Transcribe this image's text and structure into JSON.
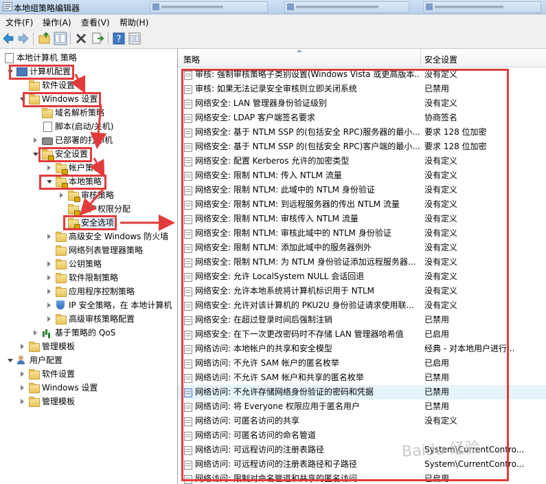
{
  "window": {
    "title": "本地组策略编辑器"
  },
  "menu": [
    "文件(F)",
    "操作(A)",
    "查看(V)",
    "帮助(H)"
  ],
  "toolbar": [
    {
      "icon": "back-arrow-icon"
    },
    {
      "icon": "forward-arrow-icon"
    },
    {
      "icon": "up-folder-icon"
    },
    {
      "icon": "show-hide-tree-icon"
    },
    {
      "icon": "delete-x-icon"
    },
    {
      "icon": "export-list-icon"
    },
    {
      "icon": "help-icon"
    },
    {
      "icon": "properties-icon"
    }
  ],
  "tree": [
    {
      "label": "本地计算机 策略",
      "icon": "page",
      "expand": "none"
    },
    {
      "label": "计算机配置",
      "icon": "pc",
      "expand": "open"
    },
    {
      "label": "软件设置",
      "icon": "folder",
      "expand": "none"
    },
    {
      "label": "Windows 设置",
      "icon": "folder",
      "expand": "open"
    },
    {
      "label": "域名解析策略",
      "icon": "folder",
      "expand": "none"
    },
    {
      "label": "脚本(启动/关机)",
      "icon": "page",
      "expand": "none"
    },
    {
      "label": "已部署的打印机",
      "icon": "printer",
      "expand": "closed"
    },
    {
      "label": "安全设置",
      "icon": "folder-lock",
      "expand": "open"
    },
    {
      "label": "帐户策略",
      "icon": "folder-lock",
      "expand": "closed"
    },
    {
      "label": "本地策略",
      "icon": "folder-lock",
      "expand": "open"
    },
    {
      "label": "审核策略",
      "icon": "folder-lock",
      "expand": "closed"
    },
    {
      "label": "用户权限分配",
      "icon": "folder-lock",
      "expand": "none"
    },
    {
      "label": "安全选项",
      "icon": "folder-lock",
      "expand": "none"
    },
    {
      "label": "高级安全 Windows 防火墙",
      "icon": "folder",
      "expand": "closed"
    },
    {
      "label": "网络列表管理器策略",
      "icon": "folder",
      "expand": "none"
    },
    {
      "label": "公钥策略",
      "icon": "folder",
      "expand": "closed"
    },
    {
      "label": "软件限制策略",
      "icon": "folder",
      "expand": "closed"
    },
    {
      "label": "应用程序控制策略",
      "icon": "folder",
      "expand": "closed"
    },
    {
      "label": "IP 安全策略，在 本地计算机",
      "icon": "shield",
      "expand": "closed"
    },
    {
      "label": "高级审核策略配置",
      "icon": "folder",
      "expand": "closed"
    },
    {
      "label": "基于策略的 QoS",
      "icon": "chart",
      "expand": "closed"
    },
    {
      "label": "管理模板",
      "icon": "folder",
      "expand": "closed"
    },
    {
      "label": "用户配置",
      "icon": "user",
      "expand": "open"
    },
    {
      "label": "软件设置",
      "icon": "folder",
      "expand": "closed"
    },
    {
      "label": "Windows 设置",
      "icon": "folder",
      "expand": "closed"
    },
    {
      "label": "管理模板",
      "icon": "folder",
      "expand": "closed"
    }
  ],
  "list": {
    "col_policy": "策略",
    "col_setting": "安全设置",
    "rows": [
      {
        "policy": "审核: 强制审核策略子类别设置(Windows Vista 或更高版本...",
        "setting": "没有定义"
      },
      {
        "policy": "审核: 如果无法记录安全审核则立即关闭系统",
        "setting": "已禁用"
      },
      {
        "policy": "网络安全: LAN 管理器身份验证级别",
        "setting": "没有定义"
      },
      {
        "policy": "网络安全: LDAP 客户端签名要求",
        "setting": "协商签名"
      },
      {
        "policy": "网络安全: 基于 NTLM SSP 的(包括安全 RPC)服务器的最小...",
        "setting": "要求 128 位加密"
      },
      {
        "policy": "网络安全: 基于 NTLM SSP 的(包括安全 RPC)客户端的最小...",
        "setting": "要求 128 位加密"
      },
      {
        "policy": "网络安全: 配置 Kerberos 允许的加密类型",
        "setting": "没有定义"
      },
      {
        "policy": "网络安全: 限制 NTLM: 传入 NTLM 流量",
        "setting": "没有定义"
      },
      {
        "policy": "网络安全: 限制 NTLM: 此域中的 NTLM 身份验证",
        "setting": "没有定义"
      },
      {
        "policy": "网络安全: 限制 NTLM: 到远程服务器的传出 NTLM 流量",
        "setting": "没有定义"
      },
      {
        "policy": "网络安全: 限制 NTLM: 审核传入 NTLM 流量",
        "setting": "没有定义"
      },
      {
        "policy": "网络安全: 限制 NTLM: 审核此域中的 NTLM 身份验证",
        "setting": "没有定义"
      },
      {
        "policy": "网络安全: 限制 NTLM: 添加此域中的服务器例外",
        "setting": "没有定义"
      },
      {
        "policy": "网络安全: 限制 NTLM: 为 NTLM 身份验证添加远程服务器...",
        "setting": "没有定义"
      },
      {
        "policy": "网络安全: 允许 LocalSystem NULL 会话回退",
        "setting": "没有定义"
      },
      {
        "policy": "网络安全: 允许本地系统将计算机标识用于 NTLM",
        "setting": "没有定义"
      },
      {
        "policy": "网络安全: 允许对该计算机的 PKU2U 身份验证请求使用联...",
        "setting": "没有定义"
      },
      {
        "policy": "网络安全: 在超过登录时间后强制注销",
        "setting": "已禁用"
      },
      {
        "policy": "网络安全: 在下一次更改密码时不存储 LAN 管理器哈希值",
        "setting": "已启用"
      },
      {
        "policy": "网络访问: 本地帐户的共享和安全模型",
        "setting": "经典 - 对本地用户进行..."
      },
      {
        "policy": "网络访问: 不允许 SAM 帐户的匿名枚举",
        "setting": "已启用"
      },
      {
        "policy": "网络访问: 不允许 SAM 帐户和共享的匿名枚举",
        "setting": "已禁用"
      },
      {
        "policy": "网络访问: 不允许存储网络身份验证的密码和凭据",
        "setting": "已禁用"
      },
      {
        "policy": "网络访问: 将 Everyone 权限应用于匿名用户",
        "setting": "已禁用"
      },
      {
        "policy": "网络访问: 可匿名访问的共享",
        "setting": "没有定义"
      },
      {
        "policy": "网络访问: 可匿名访问的命名管道",
        "setting": ""
      },
      {
        "policy": "网络访问: 可远程访问的注册表路径",
        "setting": "System\\CurrentContro..."
      },
      {
        "policy": "网络访问: 可远程访问的注册表路径和子路径",
        "setting": "System\\CurrentContro..."
      },
      {
        "policy": "网络访问: 限制对命名管道和共享的匿名访问",
        "setting": "已启用"
      }
    ]
  },
  "watermark": "Baidu 经验"
}
